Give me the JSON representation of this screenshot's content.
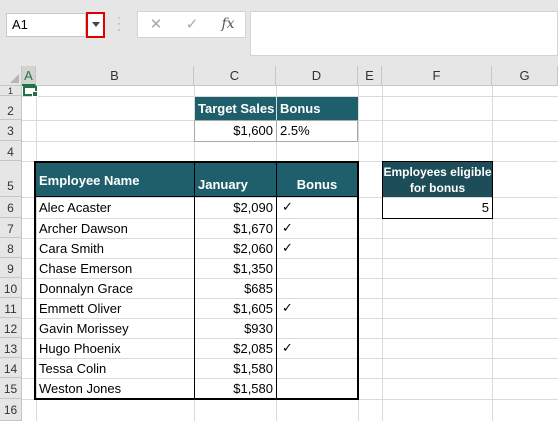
{
  "formula_bar": {
    "name_box": "A1",
    "cancel_glyph": "✕",
    "enter_glyph": "✓",
    "fx_label": "fx",
    "formula": ""
  },
  "columns": [
    "A",
    "B",
    "C",
    "D",
    "E",
    "F",
    "G"
  ],
  "rows": [
    "1",
    "2",
    "3",
    "4",
    "5",
    "6",
    "7",
    "8",
    "9",
    "10",
    "11",
    "12",
    "13",
    "14",
    "15",
    "16"
  ],
  "sales_target": {
    "header_target": "Target Sales",
    "header_bonus": "Bonus",
    "target_value": "$1,600",
    "bonus_value": "2.5%"
  },
  "main_table": {
    "headers": [
      "Employee Name",
      "January",
      "Bonus"
    ],
    "rows": [
      {
        "name": "Alec Acaster",
        "january": "$2,090",
        "bonus": "✓"
      },
      {
        "name": "Archer Dawson",
        "january": "$1,670",
        "bonus": "✓"
      },
      {
        "name": "Cara Smith",
        "january": "$2,060",
        "bonus": "✓"
      },
      {
        "name": "Chase Emerson",
        "january": "$1,350",
        "bonus": ""
      },
      {
        "name": "Donnalyn Grace",
        "january": "$685",
        "bonus": ""
      },
      {
        "name": "Emmett Oliver",
        "january": "$1,605",
        "bonus": "✓"
      },
      {
        "name": "Gavin Morissey",
        "january": "$930",
        "bonus": ""
      },
      {
        "name": "Hugo Phoenix",
        "january": "$2,085",
        "bonus": "✓"
      },
      {
        "name": "Tessa Colin",
        "january": "$1,580",
        "bonus": ""
      },
      {
        "name": "Weston Jones",
        "january": "$1,580",
        "bonus": ""
      }
    ]
  },
  "eligible_box": {
    "header_line1": "Employees eligible",
    "header_line2": "for bonus",
    "value": "5"
  },
  "colors": {
    "header_bg": "#1f5f6c",
    "selection_accent": "#217346",
    "highlight_border": "#e00000"
  }
}
